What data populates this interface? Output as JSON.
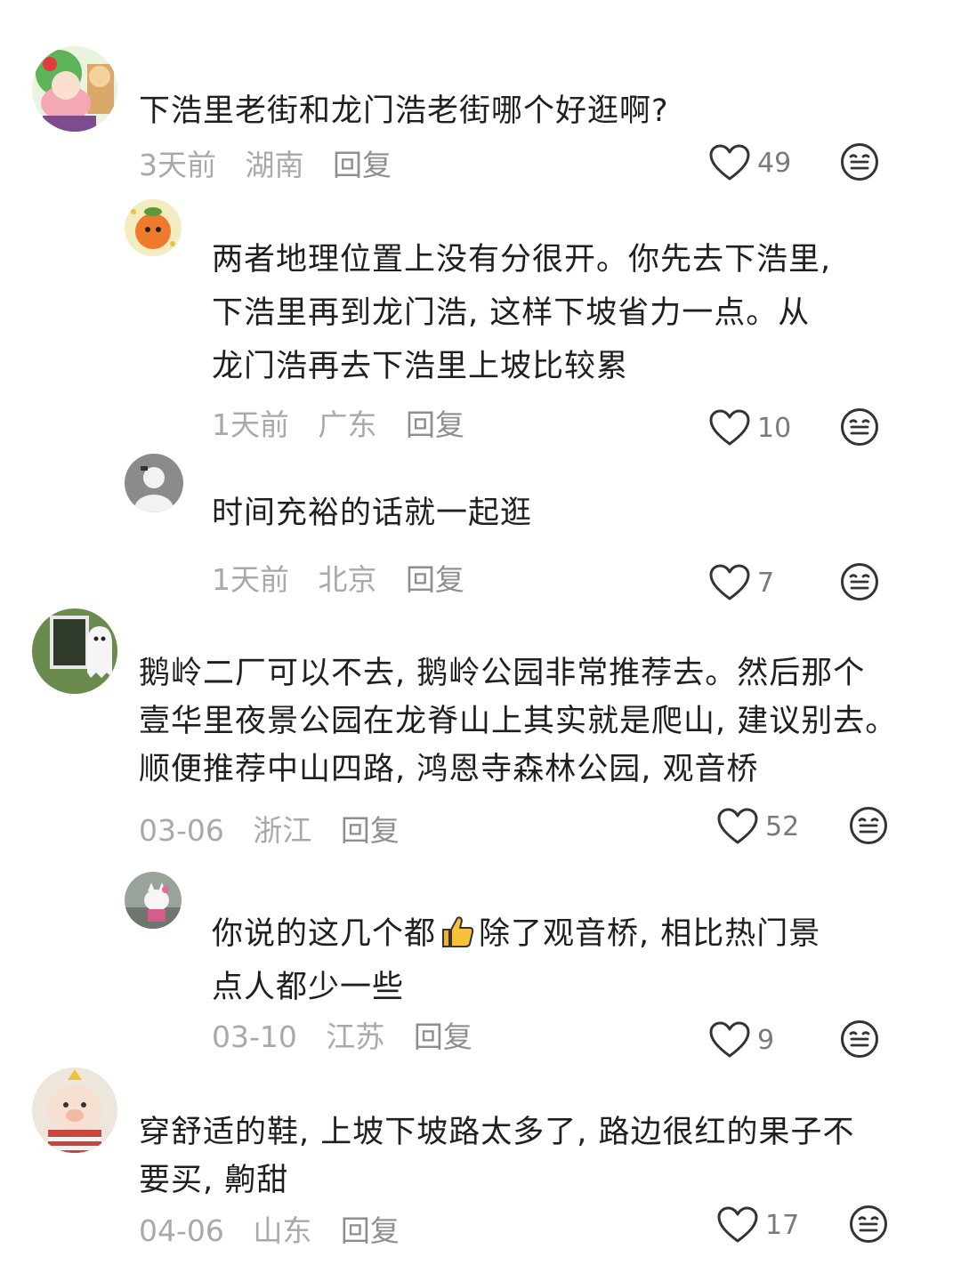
{
  "comments": [
    {
      "avatar": "cartoon-character-avatar",
      "text": "下浩里老街和龙门浩老街哪个好逛啊?",
      "time": "3天前",
      "location": "湖南",
      "reply_label": "回复",
      "likes": "49"
    },
    {
      "avatar": "orange-fruit-avatar",
      "text_lines": [
        "两者地理位置上没有分很开。你先去下浩里,",
        "下浩里再到龙门浩, 这样下坡省力一点。从",
        "龙门浩再去下浩里上坡比较累"
      ],
      "time": "1天前",
      "location": "广东",
      "reply_label": "回复",
      "likes": "10"
    },
    {
      "avatar": "default-user-avatar",
      "text": "时间充裕的话就一起逛",
      "time": "1天前",
      "location": "北京",
      "reply_label": "回复",
      "likes": "7"
    },
    {
      "avatar": "ghost-window-avatar",
      "text_lines": [
        "鹅岭二厂可以不去, 鹅岭公园非常推荐去。然后那个",
        "壹华里夜景公园在龙脊山上其实就是爬山, 建议别去。",
        "顺便推荐中山四路, 鸿恩寺森林公园, 观音桥"
      ],
      "time": "03-06",
      "location": "浙江",
      "reply_label": "回复",
      "likes": "52"
    },
    {
      "avatar": "kitty-figure-avatar",
      "text_before_emoji": "你说的这几个都",
      "emoji": "thumbs-up-icon",
      "text_after_emoji": "除了观音桥, 相比热门景",
      "text_line2": "点人都少一些",
      "time": "03-10",
      "location": "江苏",
      "reply_label": "回复",
      "likes": "9"
    },
    {
      "avatar": "plush-pig-avatar",
      "text_lines": [
        "穿舒适的鞋, 上坡下坡路太多了, 路边很红的果子不",
        "要买, 齁甜"
      ],
      "time": "04-06",
      "location": "山东",
      "reply_label": "回复",
      "likes": "17"
    }
  ],
  "colors": {
    "text": "#1f1f1f",
    "meta": "#a9a9a9",
    "icon": "#333333"
  }
}
